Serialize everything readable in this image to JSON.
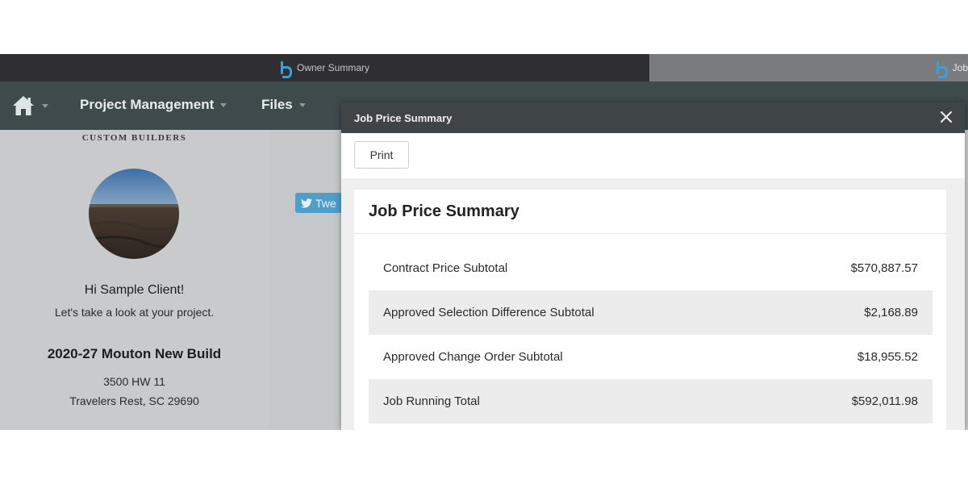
{
  "browser": {
    "tabs": [
      {
        "label": "Owner Summary",
        "active": true,
        "icon": "buildertrend-logo-icon"
      },
      {
        "label": "Job",
        "active": false,
        "icon": "buildertrend-logo-icon"
      }
    ]
  },
  "navbar": {
    "home_icon": "home-icon",
    "items": [
      {
        "label": "Project Management"
      },
      {
        "label": "Files"
      }
    ]
  },
  "profile": {
    "brand": "CUSTOM BUILDERS",
    "greeting": "Hi Sample Client!",
    "sub_greeting": "Let's take a look at your project.",
    "job_name": "2020-27 Mouton New Build",
    "address_line1": "3500 HW 11",
    "address_line2": "Travelers Rest, SC 29690"
  },
  "social": {
    "tweet_label": "Twe"
  },
  "modal": {
    "title": "Job Price Summary",
    "print_label": "Print",
    "card_title": "Job Price Summary",
    "rows": [
      {
        "label": "Contract Price Subtotal",
        "amount": "$570,887.57"
      },
      {
        "label": "Approved Selection Difference Subtotal",
        "amount": "$2,168.89"
      },
      {
        "label": "Approved Change Order Subtotal",
        "amount": "$18,955.52"
      },
      {
        "label": "Job Running Total",
        "amount": "$592,011.98"
      }
    ]
  },
  "colors": {
    "navbar": "#3f4a4d",
    "modal_header": "#3f4547",
    "tab_logo": "#3aa0d8",
    "tweet_button": "#4f9dc9"
  }
}
